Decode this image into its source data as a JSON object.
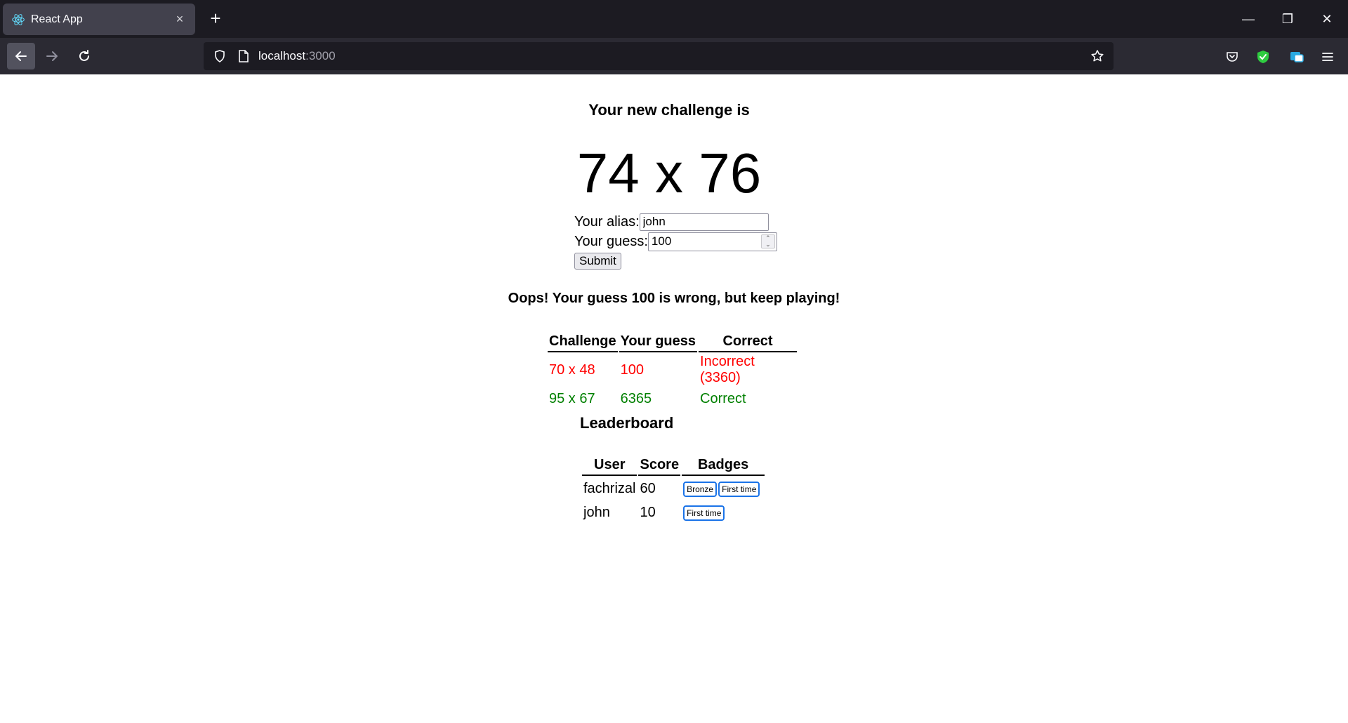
{
  "browser": {
    "tab_title": "React App",
    "tab_close": "×",
    "new_tab": "+",
    "url_host": "localhost",
    "url_port": ":3000"
  },
  "window_controls": {
    "minimize": "—",
    "restore": "❐",
    "close": "✕"
  },
  "page": {
    "heading": "Your new challenge is",
    "challenge": "74 x 76",
    "form": {
      "alias_label": "Your alias:",
      "alias_value": "john",
      "guess_label": "Your guess:",
      "guess_value": "100",
      "submit_label": "Submit"
    },
    "result_message": "Oops! Your guess 100 is wrong, but keep playing!",
    "attempts": {
      "headers": [
        "Challenge",
        "Your guess",
        "Correct"
      ],
      "rows": [
        {
          "challenge": "70 x 48",
          "guess": "100",
          "correct": "Incorrect (3360)",
          "status": "incorrect"
        },
        {
          "challenge": "95 x 67",
          "guess": "6365",
          "correct": "Correct",
          "status": "correct"
        }
      ]
    },
    "leaderboard": {
      "title": "Leaderboard",
      "headers": [
        "User",
        "Score",
        "Badges"
      ],
      "rows": [
        {
          "user": "fachrizal",
          "score": "60",
          "badges": [
            "Bronze",
            "First time"
          ]
        },
        {
          "user": "john",
          "score": "10",
          "badges": [
            "First time"
          ]
        }
      ]
    }
  },
  "colors": {
    "incorrect": "#ff0000",
    "correct": "#008000",
    "badge_border": "#1a73e8"
  }
}
